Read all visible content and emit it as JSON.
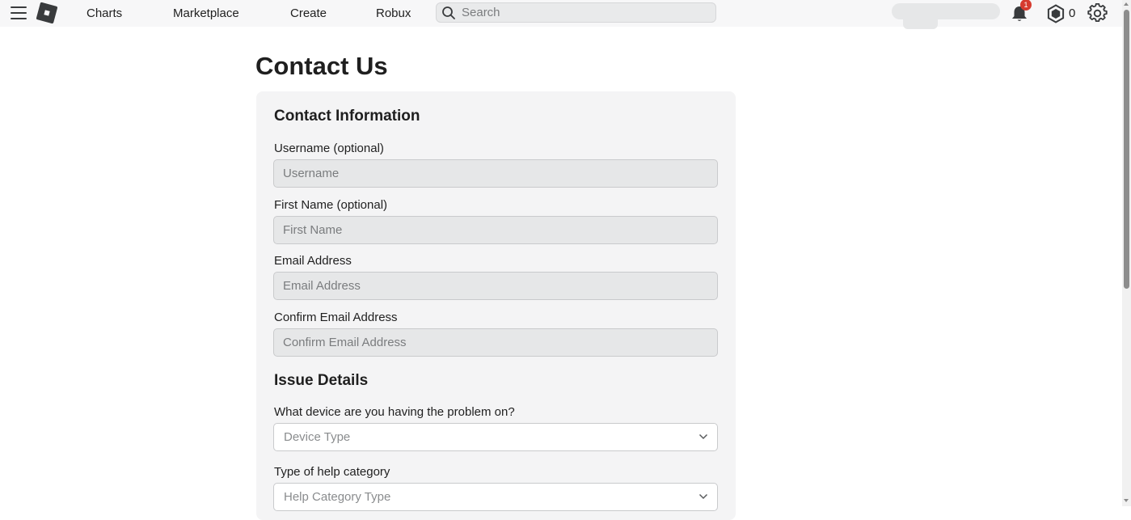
{
  "nav": {
    "links": [
      "Charts",
      "Marketplace",
      "Create",
      "Robux"
    ],
    "search_placeholder": "Search",
    "notification_count": "1",
    "robux_balance": "0"
  },
  "page": {
    "title": "Contact Us"
  },
  "contact_section": {
    "title": "Contact Information",
    "fields": [
      {
        "label": "Username (optional)",
        "placeholder": "Username"
      },
      {
        "label": "First Name (optional)",
        "placeholder": "First Name"
      },
      {
        "label": "Email Address",
        "placeholder": "Email Address"
      },
      {
        "label": "Confirm Email Address",
        "placeholder": "Confirm Email Address"
      }
    ]
  },
  "issue_section": {
    "title": "Issue Details",
    "selects": [
      {
        "label": "What device are you having the problem on?",
        "placeholder": "Device Type"
      },
      {
        "label": "Type of help category",
        "placeholder": "Help Category Type"
      }
    ]
  },
  "colors": {
    "notification_badge": "#d63b2f",
    "card_background": "#f4f4f5",
    "input_background": "#e6e7e8"
  }
}
